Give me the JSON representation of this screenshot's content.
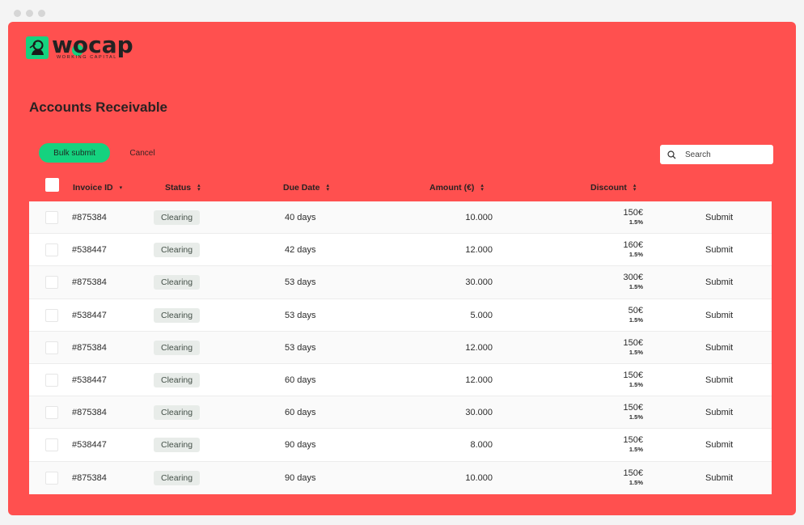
{
  "brand": {
    "name": "wocap",
    "tagline": "WORKING CAPITAL",
    "accent": "#15d27f",
    "background": "#ff504f"
  },
  "page": {
    "title": "Accounts Receivable"
  },
  "actions": {
    "bulk_submit": "Bulk submit",
    "cancel": "Cancel"
  },
  "search": {
    "placeholder": "Search"
  },
  "columns": {
    "invoice_id": "Invoice ID",
    "status": "Status",
    "due_date": "Due Date",
    "amount": "Amount (€)",
    "discount": "Discount"
  },
  "rows": [
    {
      "id": "#875384",
      "status": "Clearing",
      "due": "40 days",
      "amount": "10.000",
      "discount": "150€",
      "pct": "1.5%",
      "action": "Submit"
    },
    {
      "id": "#538447",
      "status": "Clearing",
      "due": "42 days",
      "amount": "12.000",
      "discount": "160€",
      "pct": "1.5%",
      "action": "Submit"
    },
    {
      "id": "#875384",
      "status": "Clearing",
      "due": "53 days",
      "amount": "30.000",
      "discount": "300€",
      "pct": "1.5%",
      "action": "Submit"
    },
    {
      "id": "#538447",
      "status": "Clearing",
      "due": "53 days",
      "amount": "5.000",
      "discount": "50€",
      "pct": "1.5%",
      "action": "Submit"
    },
    {
      "id": "#875384",
      "status": "Clearing",
      "due": "53 days",
      "amount": "12.000",
      "discount": "150€",
      "pct": "1.5%",
      "action": "Submit"
    },
    {
      "id": "#538447",
      "status": "Clearing",
      "due": "60 days",
      "amount": "12.000",
      "discount": "150€",
      "pct": "1.5%",
      "action": "Submit"
    },
    {
      "id": "#875384",
      "status": "Clearing",
      "due": "60 days",
      "amount": "30.000",
      "discount": "150€",
      "pct": "1.5%",
      "action": "Submit"
    },
    {
      "id": "#538447",
      "status": "Clearing",
      "due": "90 days",
      "amount": "8.000",
      "discount": "150€",
      "pct": "1.5%",
      "action": "Submit"
    },
    {
      "id": "#875384",
      "status": "Clearing",
      "due": "90 days",
      "amount": "10.000",
      "discount": "150€",
      "pct": "1.5%",
      "action": "Submit"
    }
  ],
  "icons": {
    "search": "search-icon",
    "sort": "sort-icon",
    "logo": "person-icon"
  }
}
